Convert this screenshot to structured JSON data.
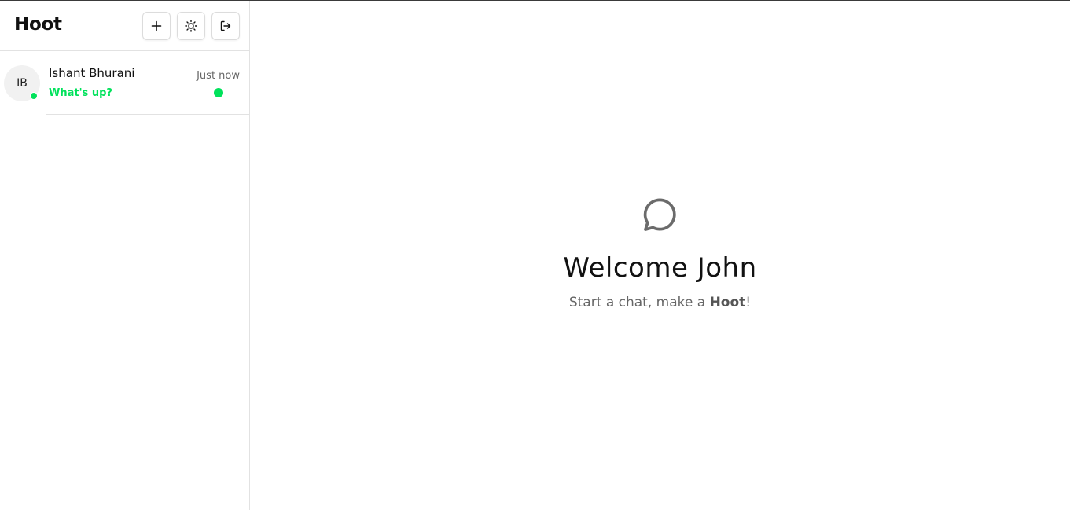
{
  "app": {
    "title": "Hoot"
  },
  "header": {
    "buttons": [
      {
        "name": "new-chat",
        "icon": "plus-icon"
      },
      {
        "name": "theme-toggle",
        "icon": "sun-icon"
      },
      {
        "name": "logout",
        "icon": "logout-icon"
      }
    ]
  },
  "chats": [
    {
      "initials": "IB",
      "name": "Ishant Bhurani",
      "last_message": "What's up?",
      "time": "Just now",
      "online": true,
      "unread": true
    }
  ],
  "welcome": {
    "icon": "message-circle-icon",
    "title": "Welcome John",
    "subtitle_prefix": "Start a chat, make a ",
    "subtitle_brand": "Hoot",
    "subtitle_suffix": "!"
  },
  "colors": {
    "accent": "#00e25b",
    "muted_text": "#666666",
    "border": "#e2e2e2"
  }
}
